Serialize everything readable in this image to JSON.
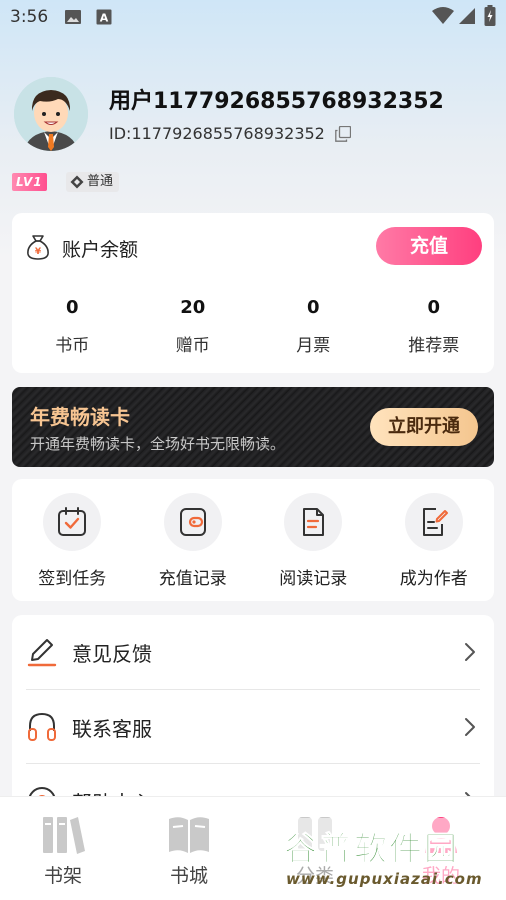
{
  "status_bar": {
    "time": "3:56",
    "left_icons": [
      "image-icon",
      "a-text-icon"
    ],
    "right_icons": [
      "wifi-icon",
      "signal-icon",
      "battery-icon"
    ]
  },
  "profile": {
    "username": "用户1177926855768932352",
    "id_label": "ID: ",
    "id_value": "1177926855768932352",
    "level": "LV1",
    "member_type": "普通"
  },
  "balance": {
    "title": "账户余额",
    "recharge_label": "充值",
    "stats": [
      {
        "value": "0",
        "label": "书币"
      },
      {
        "value": "20",
        "label": "赠币"
      },
      {
        "value": "0",
        "label": "月票"
      },
      {
        "value": "0",
        "label": "推荐票"
      }
    ]
  },
  "vip": {
    "title": "年费畅读卡",
    "subtitle": "开通年费畅读卡，全场好书无限畅读。",
    "button_label": "立即开通"
  },
  "actions": [
    {
      "label": "签到任务",
      "icon": "calendar-check-icon"
    },
    {
      "label": "充值记录",
      "icon": "wallet-icon"
    },
    {
      "label": "阅读记录",
      "icon": "document-icon"
    },
    {
      "label": "成为作者",
      "icon": "edit-document-icon"
    }
  ],
  "menu": [
    {
      "label": "意见反馈",
      "icon": "pen-icon"
    },
    {
      "label": "联系客服",
      "icon": "headphones-icon"
    },
    {
      "label": "帮助中心",
      "icon": "help-icon"
    }
  ],
  "bottom_nav": [
    {
      "label": "书架",
      "icon": "bookshelf-icon"
    },
    {
      "label": "书城",
      "icon": "book-open-icon"
    },
    {
      "label": "分类",
      "icon": "category-icon"
    },
    {
      "label": "我的",
      "icon": "profile-icon"
    }
  ],
  "watermark": {
    "title": "谷普软件园",
    "url": "www.gupuxiazai.com"
  },
  "colors": {
    "accent": "#ff3f7f",
    "vip_gold": "#f7c592",
    "icon_orange": "#f06a3a"
  }
}
